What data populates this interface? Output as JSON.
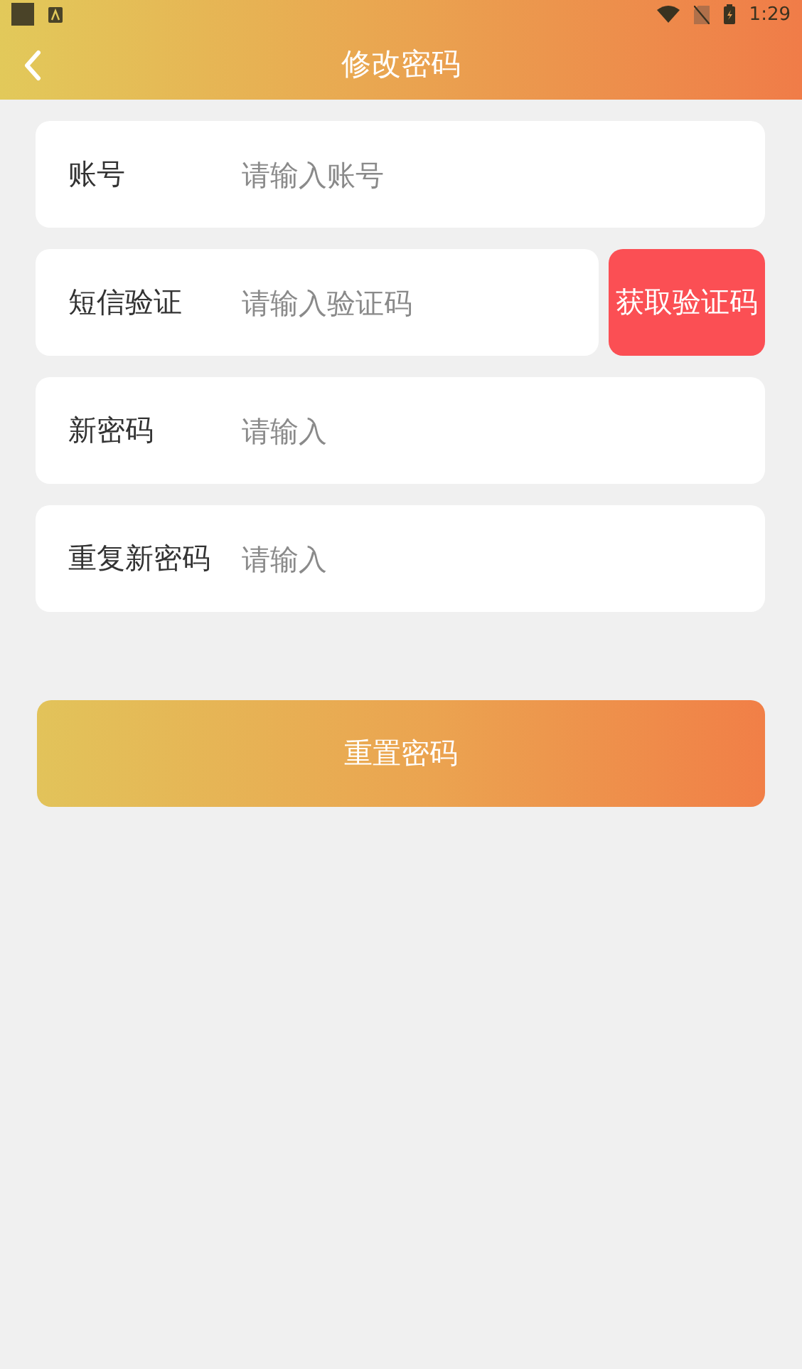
{
  "status_bar": {
    "time": "1:29"
  },
  "header": {
    "title": "修改密码"
  },
  "fields": [
    {
      "label": "账号",
      "placeholder": "请输入账号"
    },
    {
      "label": "短信验证",
      "placeholder": "请输入验证码",
      "action": "获取验证码"
    },
    {
      "label": "新密码",
      "placeholder": "请输入"
    },
    {
      "label": "重复新密码",
      "placeholder": "请输入"
    }
  ],
  "submit": "重置密码"
}
